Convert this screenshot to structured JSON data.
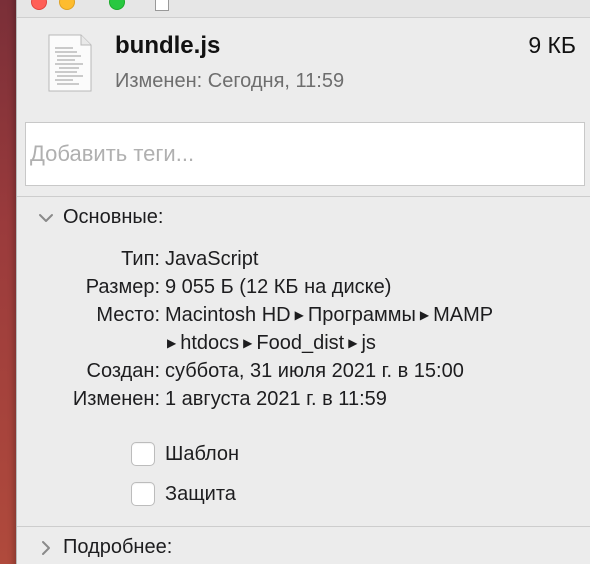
{
  "header": {
    "file_name": "bundle.js",
    "file_size": "9 КБ",
    "modified_label": "Изменен:",
    "modified_value": "Сегодня, 11:59",
    "file_icon": "document-icon"
  },
  "tags": {
    "placeholder": "Добавить теги..."
  },
  "general": {
    "title": "Основные:",
    "rows": [
      {
        "label": "Тип:",
        "value": "JavaScript"
      },
      {
        "label": "Размер:",
        "value": "9 055 Б (12 КБ на диске)"
      },
      {
        "label": "Место:",
        "path1": [
          "Macintosh HD",
          "Программы",
          "MAMP"
        ],
        "path2": [
          "htdocs",
          "Food_dist",
          "js"
        ]
      },
      {
        "label": "Создан:",
        "value": "суббота, 31 июля 2021 г. в 15:00"
      },
      {
        "label": "Изменен:",
        "value": "1 августа 2021 г. в 11:59"
      }
    ],
    "checkboxes": [
      {
        "label": "Шаблон",
        "checked": false
      },
      {
        "label": "Защита",
        "checked": false
      }
    ]
  },
  "more": {
    "title": "Подробнее:"
  },
  "colors": {
    "close": "#ff5f57",
    "minimize": "#febc2e",
    "maximize": "#28c840"
  }
}
